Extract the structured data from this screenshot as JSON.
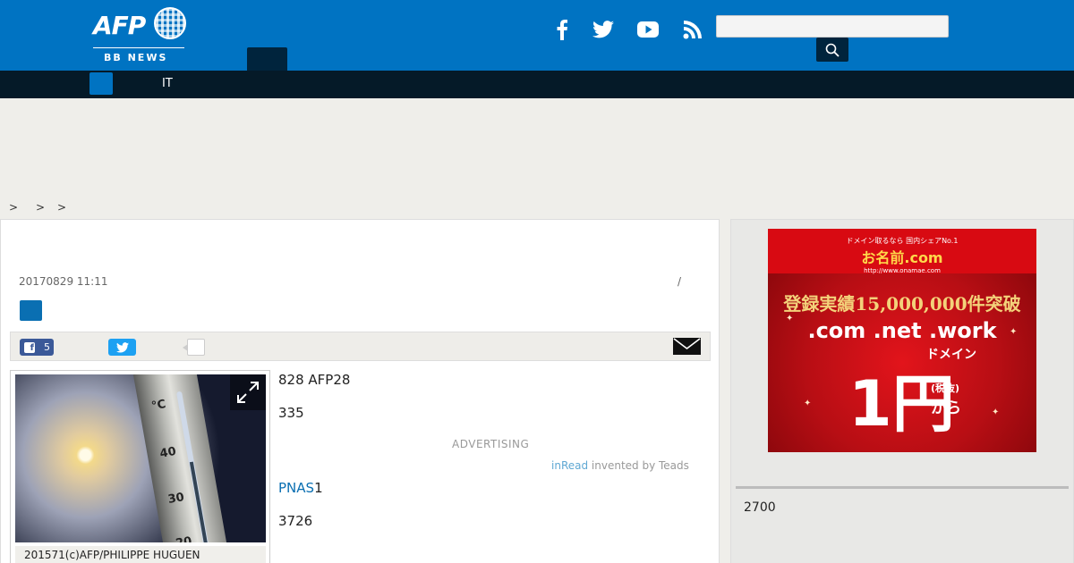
{
  "header": {
    "logo_text": "AFP",
    "logo_sub": "BB NEWS",
    "search_placeholder": ""
  },
  "nav": {
    "items": [
      {
        "label": "IT"
      }
    ]
  },
  "breadcrumb": [
    ">",
    ">",
    ">"
  ],
  "article": {
    "date": "20170829 11:11",
    "date_slash": "/",
    "share": {
      "facebook_count": "5"
    },
    "photo_caption": "201571(c)AFP/PHILIPPE HUGUEN",
    "thermo_labels": [
      "°C",
      "40",
      "30",
      "20"
    ],
    "paragraphs": [
      "828 AFP28",
      "335",
      "PNAS",
      "1",
      "3726"
    ],
    "ad_label": "ADVERTISING",
    "teads_inread": "inRead",
    "teads_rest": " invented by Teads"
  },
  "sidebar": {
    "ad": {
      "top_small": "ドメイン取るなら 国内シェアNo.1",
      "brand": "お名前.com",
      "url": "http://www.onamae.com",
      "line1": "登録実績15,000,000件突破",
      "line2": ".com .net .work",
      "line3": "ドメイン",
      "big": "1円",
      "tax": "(税抜)",
      "kara": "から"
    },
    "text": "2700"
  },
  "colors": {
    "header_bg": "#0073c2",
    "nav_bg": "#051a28",
    "accent_dark": "#00243d",
    "facebook": "#3b5998",
    "twitter": "#1da1f2"
  }
}
